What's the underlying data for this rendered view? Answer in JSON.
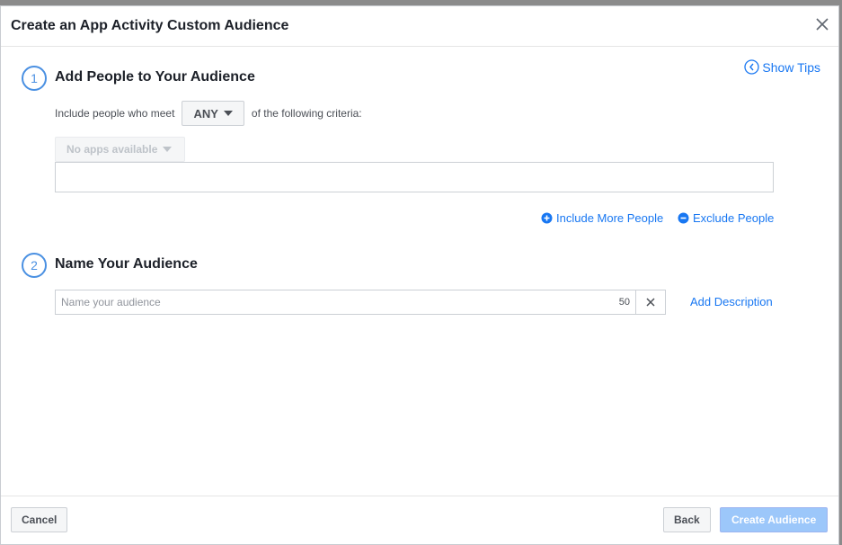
{
  "dialog": {
    "title": "Create an App Activity Custom Audience",
    "show_tips_label": "Show Tips"
  },
  "step1": {
    "number": "1",
    "title": "Add People to Your Audience",
    "criteria_prefix": "Include people who meet",
    "match_value": "ANY",
    "criteria_suffix": "of the following criteria:",
    "app_dropdown_label": "No apps available",
    "include_more_label": "Include More People",
    "exclude_label": "Exclude People"
  },
  "step2": {
    "number": "2",
    "title": "Name Your Audience",
    "name_placeholder": "Name your audience",
    "name_value": "",
    "char_remaining": "50",
    "add_description_label": "Add Description"
  },
  "footer": {
    "cancel_label": "Cancel",
    "back_label": "Back",
    "create_label": "Create Audience"
  },
  "colors": {
    "link": "#1877f2",
    "step_circle": "#4a90e2",
    "primary_disabled": "#9cc7fa"
  },
  "icons": {
    "close": "close-icon",
    "show_tips": "chevron-left-circle-icon",
    "include": "plus-circle-icon",
    "exclude": "minus-circle-icon",
    "clear": "close-icon"
  }
}
